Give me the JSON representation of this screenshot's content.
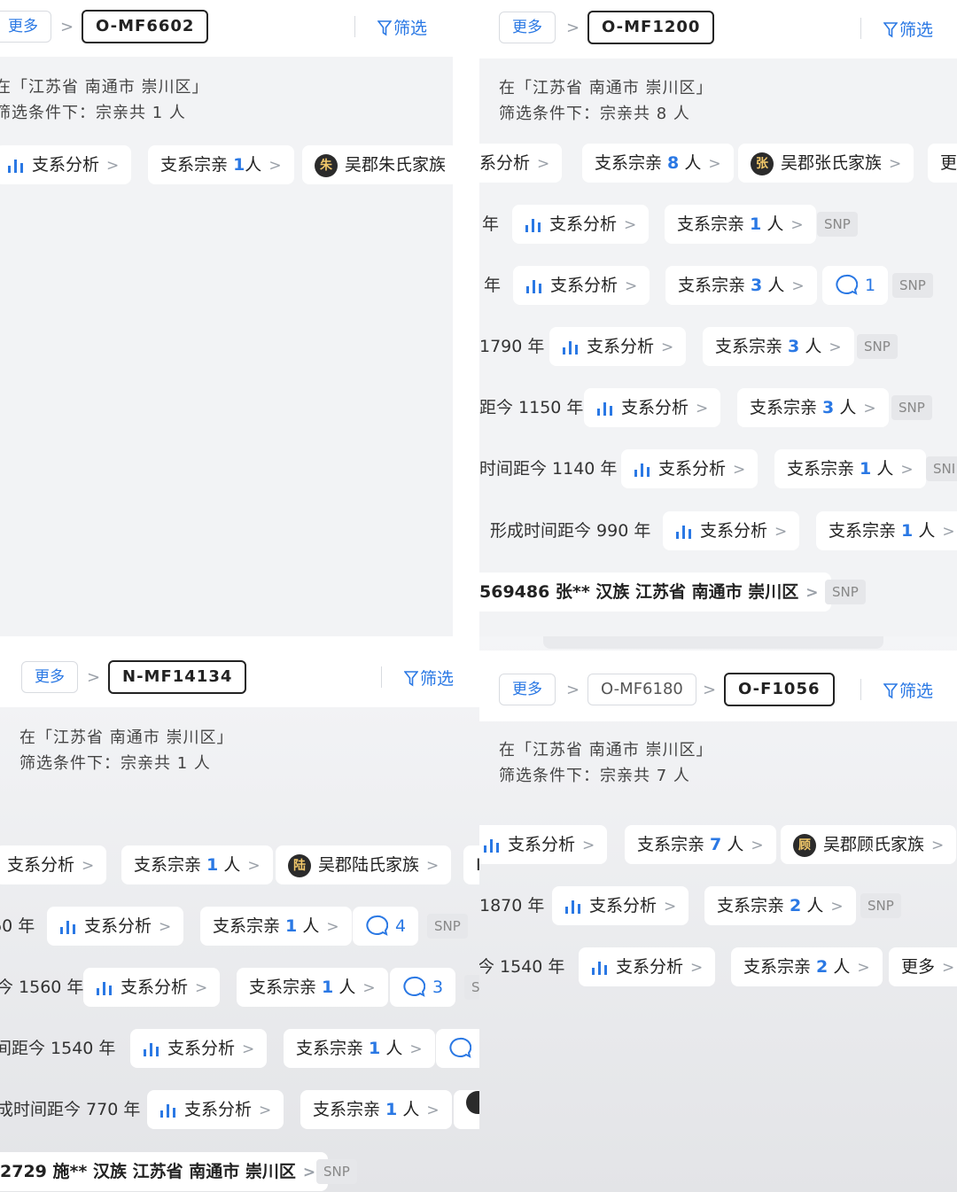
{
  "common": {
    "more": "更多",
    "filter": "筛选",
    "snp": "SNP",
    "analysis": "支系分析"
  },
  "p1": {
    "crumb": "O-MF6602",
    "summary_l1": "在「江苏省 南通市 崇川区」",
    "summary_l2": "筛选条件下：宗亲共 1 人",
    "kin_prefix": "支系宗亲",
    "kin_num": "1",
    "kin_suffix": "人",
    "clan": "吴郡朱氏家族",
    "clan_seal": "朱"
  },
  "p2": {
    "crumb": "O-MF1200",
    "summary_l1": "在「江苏省 南通市 崇川区」",
    "summary_l2": "筛选条件下：宗亲共 8 人",
    "row0": {
      "analysis": "系分析",
      "kin_num": "8",
      "clan": "吴郡张氏家族",
      "clan_seal": "张",
      "more": "更"
    },
    "row1": {
      "year": "年",
      "kin_num": "1"
    },
    "row2": {
      "year": "年",
      "kin_num": "3",
      "comments": "1"
    },
    "row3": {
      "year": "1790 年",
      "kin_num": "3"
    },
    "row4": {
      "year": "距今 1150 年",
      "kin_num": "3"
    },
    "row5": {
      "year": "时间距今 1140 年",
      "kin_num": "1",
      "snp": "SNI"
    },
    "row6": {
      "year": "形成时间距今 990 年",
      "kin_num": "1"
    },
    "row7": {
      "text": "569486 张** 汉族 江苏省 南通市 崇川区"
    }
  },
  "p3": {
    "crumb": "N-MF14134",
    "summary_l1": "在「江苏省 南通市 崇川区」",
    "summary_l2": "筛选条件下：宗亲共 1 人",
    "row0": {
      "kin_num": "1",
      "clan": "吴郡陆氏家族",
      "clan_seal": "陆",
      "tail": "I"
    },
    "row1": {
      "year": "60 年",
      "kin_num": "1",
      "comments": "4"
    },
    "row2": {
      "year": "今 1560 年",
      "kin_num": "1",
      "comments": "3",
      "snp": "S"
    },
    "row3": {
      "year": "间距今 1540 年",
      "kin_num": "1"
    },
    "row4": {
      "year": "成时间距今 770 年",
      "kin_num": "1"
    },
    "row5": {
      "text": "2729 施** 汉族 江苏省 南通市 崇川区"
    }
  },
  "p4": {
    "crumb_prev": "O-MF6180",
    "crumb": "O-F1056",
    "summary_l1": "在「江苏省 南通市 崇川区」",
    "summary_l2": "筛选条件下：宗亲共 7 人",
    "row0": {
      "kin_num": "7",
      "clan": "吴郡顾氏家族",
      "clan_seal": "顾"
    },
    "row1": {
      "year": "1870 年",
      "kin_num": "2"
    },
    "row2": {
      "year": "今 1540 年",
      "kin_num": "2",
      "more": "更多"
    }
  },
  "colors": {
    "accent": "#2a78e4",
    "chip": "#ffffff",
    "background": "#f2f3f5",
    "seal": "#2b2b2b"
  }
}
